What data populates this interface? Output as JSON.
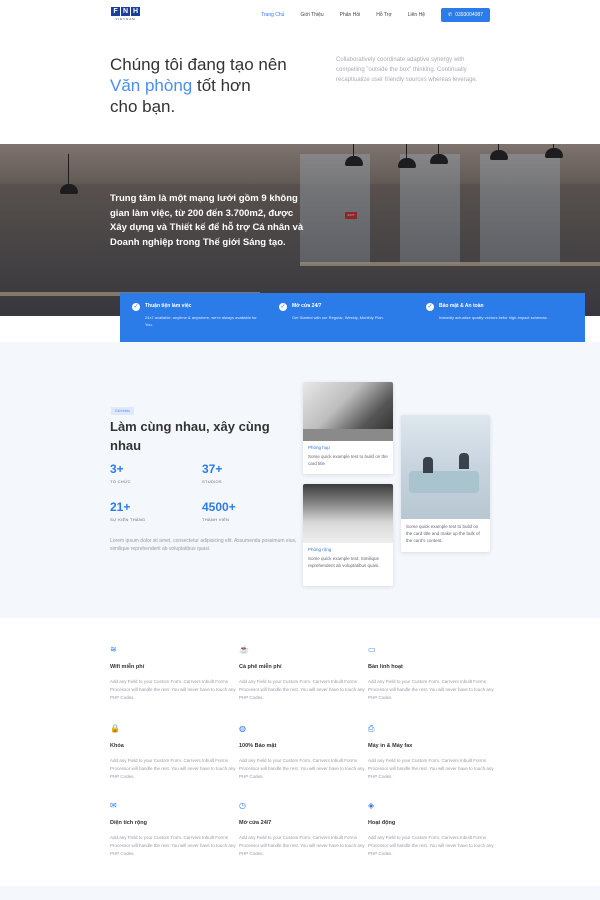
{
  "brand": {
    "letters": [
      "F",
      "N",
      "H"
    ],
    "sub": "VIETNAM"
  },
  "nav": {
    "links": [
      {
        "label": "Trang Chủ",
        "active": true
      },
      {
        "label": "Giới Thiệu",
        "active": false
      },
      {
        "label": "Phản Hồi",
        "active": false
      },
      {
        "label": "Hỗ Trợ",
        "active": false
      },
      {
        "label": "Liên Hệ",
        "active": false
      }
    ],
    "phone": "0393004087"
  },
  "hero": {
    "title_line1": "Chúng tôi đang tạo nên",
    "title_accent": "Văn phòng",
    "title_after_accent": " tốt hơn",
    "title_line3": "cho bạn.",
    "description": "Collaboratively coordinate adaptive synergy with compelling \"outside the box\" thinking. Continually recaptiualize user friendly sources whereas leverage."
  },
  "banner": {
    "text": "Trung tâm là một mạng lưới gồm 9 không gian làm việc, từ 200 đến 3.700m2, được Xây dựng và Thiết kế để hỗ trợ Cá nhân và Doanh nghiệp trong Thế giới Sáng tạo.",
    "exit_sign": "EXIT"
  },
  "strip": [
    {
      "title": "Thuận tiện làm việc",
      "desc": "24x7 available, anytime & anywhere, we're always available for You."
    },
    {
      "title": "Mở cửa 24/7",
      "desc": "Get Started with our Regular, Weekly, Monthly Plan."
    },
    {
      "title": "Bảo mật & An toàn",
      "desc": "Instantly actualize quality vectors befor high-impact schemas."
    }
  ],
  "stats": {
    "tag": "Giới thiệu",
    "title": "Làm cùng nhau, xây cùng nhau",
    "items": [
      {
        "num": "3+",
        "label": "TỔ CHỨC"
      },
      {
        "num": "37+",
        "label": "STUDIOS"
      },
      {
        "num": "21+",
        "label": "SỰ KIỆN THÁNG"
      },
      {
        "num": "4500+",
        "label": "THÀNH VIÊN"
      }
    ],
    "description": "Lorem ipsum dolor sit amet, consectetur adipisicing elit. Assumenda possimum eius, similique reprehenderit ab voluptatibus quasi."
  },
  "cards": [
    {
      "title": "Phòng họp",
      "text": "Some quick example text to build on the card title"
    },
    {
      "title": "Phòng rộng",
      "text": "Some quick example text. Similique reprehenderit ab voluptatibus quasi."
    },
    {
      "title": "",
      "text": "Some quick example text to build on the card title and make up the bulk of the card's content."
    }
  ],
  "amenities": [
    {
      "icon": "wifi-icon",
      "glyph": "≋",
      "title": "Wifi miễn phí",
      "desc": "Add any Field to your Custom Form. Carrvers Inbuilt Forms Processor will handle the rest. You will never have to touch any PHP Codes."
    },
    {
      "icon": "coffee-icon",
      "glyph": "☕",
      "title": "Cà phê miễn phí",
      "desc": "Add any Field to your Custom Form. Carrvers Inbuilt Forms Processor will handle the rest. You will never have to touch any PHP Codes."
    },
    {
      "icon": "monitor-icon",
      "glyph": "▭",
      "title": "Bàn linh hoạt",
      "desc": "Add any Field to your Custom Form. Carrvers Inbuilt Forms Processor will handle the rest. You will never have to touch any PHP Codes."
    },
    {
      "icon": "lock-icon",
      "glyph": "🔒",
      "title": "Khóa",
      "desc": "Add any Field to your Custom Form. Carrvers Inbuilt Forms Processor will handle the rest. You will never have to touch any PHP Codes."
    },
    {
      "icon": "shield-icon",
      "glyph": "◍",
      "title": "100% Bảo mật",
      "desc": "Add any Field to your Custom Form. Carrvers Inbuilt Forms Processor will handle the rest. You will never have to touch any PHP Codes."
    },
    {
      "icon": "printer-icon",
      "glyph": "⎙",
      "title": "Máy in & Máy fax",
      "desc": "Add any Field to your Custom Form. Carrvers Inbuilt Forms Processor will handle the rest. You will never have to touch any PHP Codes."
    },
    {
      "icon": "mail-icon",
      "glyph": "✉",
      "title": "Diện tích rộng",
      "desc": "Add any Field to your Custom Form. Carrvers Inbuilt Forms Processor will handle the rest. You will never have to touch any PHP Codes."
    },
    {
      "icon": "clock-icon",
      "glyph": "◷",
      "title": "Mở cửa 24/7",
      "desc": "Add any Field to your Custom Form. Carrvers Inbuilt Forms Processor will handle the rest. You will never have to touch any PHP Codes."
    },
    {
      "icon": "gamepad-icon",
      "glyph": "◈",
      "title": "Hoạt động",
      "desc": "Add any Field to your Custom Form. Carrvers Inbuilt Forms Processor will handle the rest. You will never have to touch any PHP Codes."
    }
  ],
  "colors": {
    "accent": "#2b7be8",
    "accent_text": "#4b8ef1",
    "brand": "#1b3f9b"
  }
}
